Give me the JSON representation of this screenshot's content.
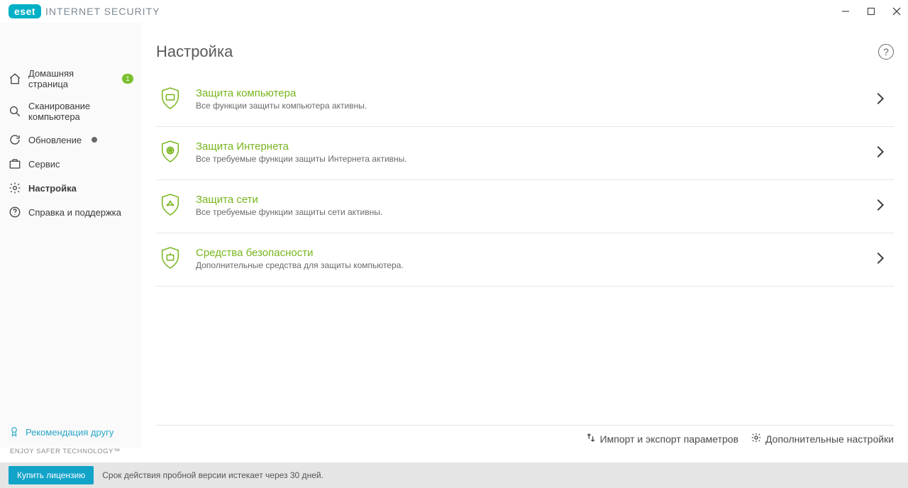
{
  "titlebar": {
    "brand": "eset",
    "product": "INTERNET SECURITY"
  },
  "sidebar": {
    "items": [
      {
        "label": "Домашняя страница",
        "badge": "1"
      },
      {
        "label": "Сканирование компьютера"
      },
      {
        "label": "Обновление",
        "dot": true
      },
      {
        "label": "Сервис"
      },
      {
        "label": "Настройка",
        "active": true
      },
      {
        "label": "Справка и поддержка"
      }
    ],
    "recommend": "Рекомендация другу"
  },
  "page": {
    "title": "Настройка",
    "help_tooltip": "?"
  },
  "tiles": [
    {
      "title": "Защита компьютера",
      "sub": "Все функции защиты компьютера активны."
    },
    {
      "title": "Защита Интернета",
      "sub": "Все требуемые функции защиты Интернета активны."
    },
    {
      "title": "Защита сети",
      "sub": "Все требуемые функции защиты сети активны."
    },
    {
      "title": "Средства безопасности",
      "sub": "Дополнительные средства для защиты компьютера."
    }
  ],
  "footer": {
    "import_export": "Импорт и экспорт параметров",
    "advanced": "Дополнительные настройки",
    "tagline": "ENJOY SAFER TECHNOLOGY™"
  },
  "statusbar": {
    "buy": "Купить лицензию",
    "trial": "Срок действия пробной версии истекает через 30 дней."
  }
}
